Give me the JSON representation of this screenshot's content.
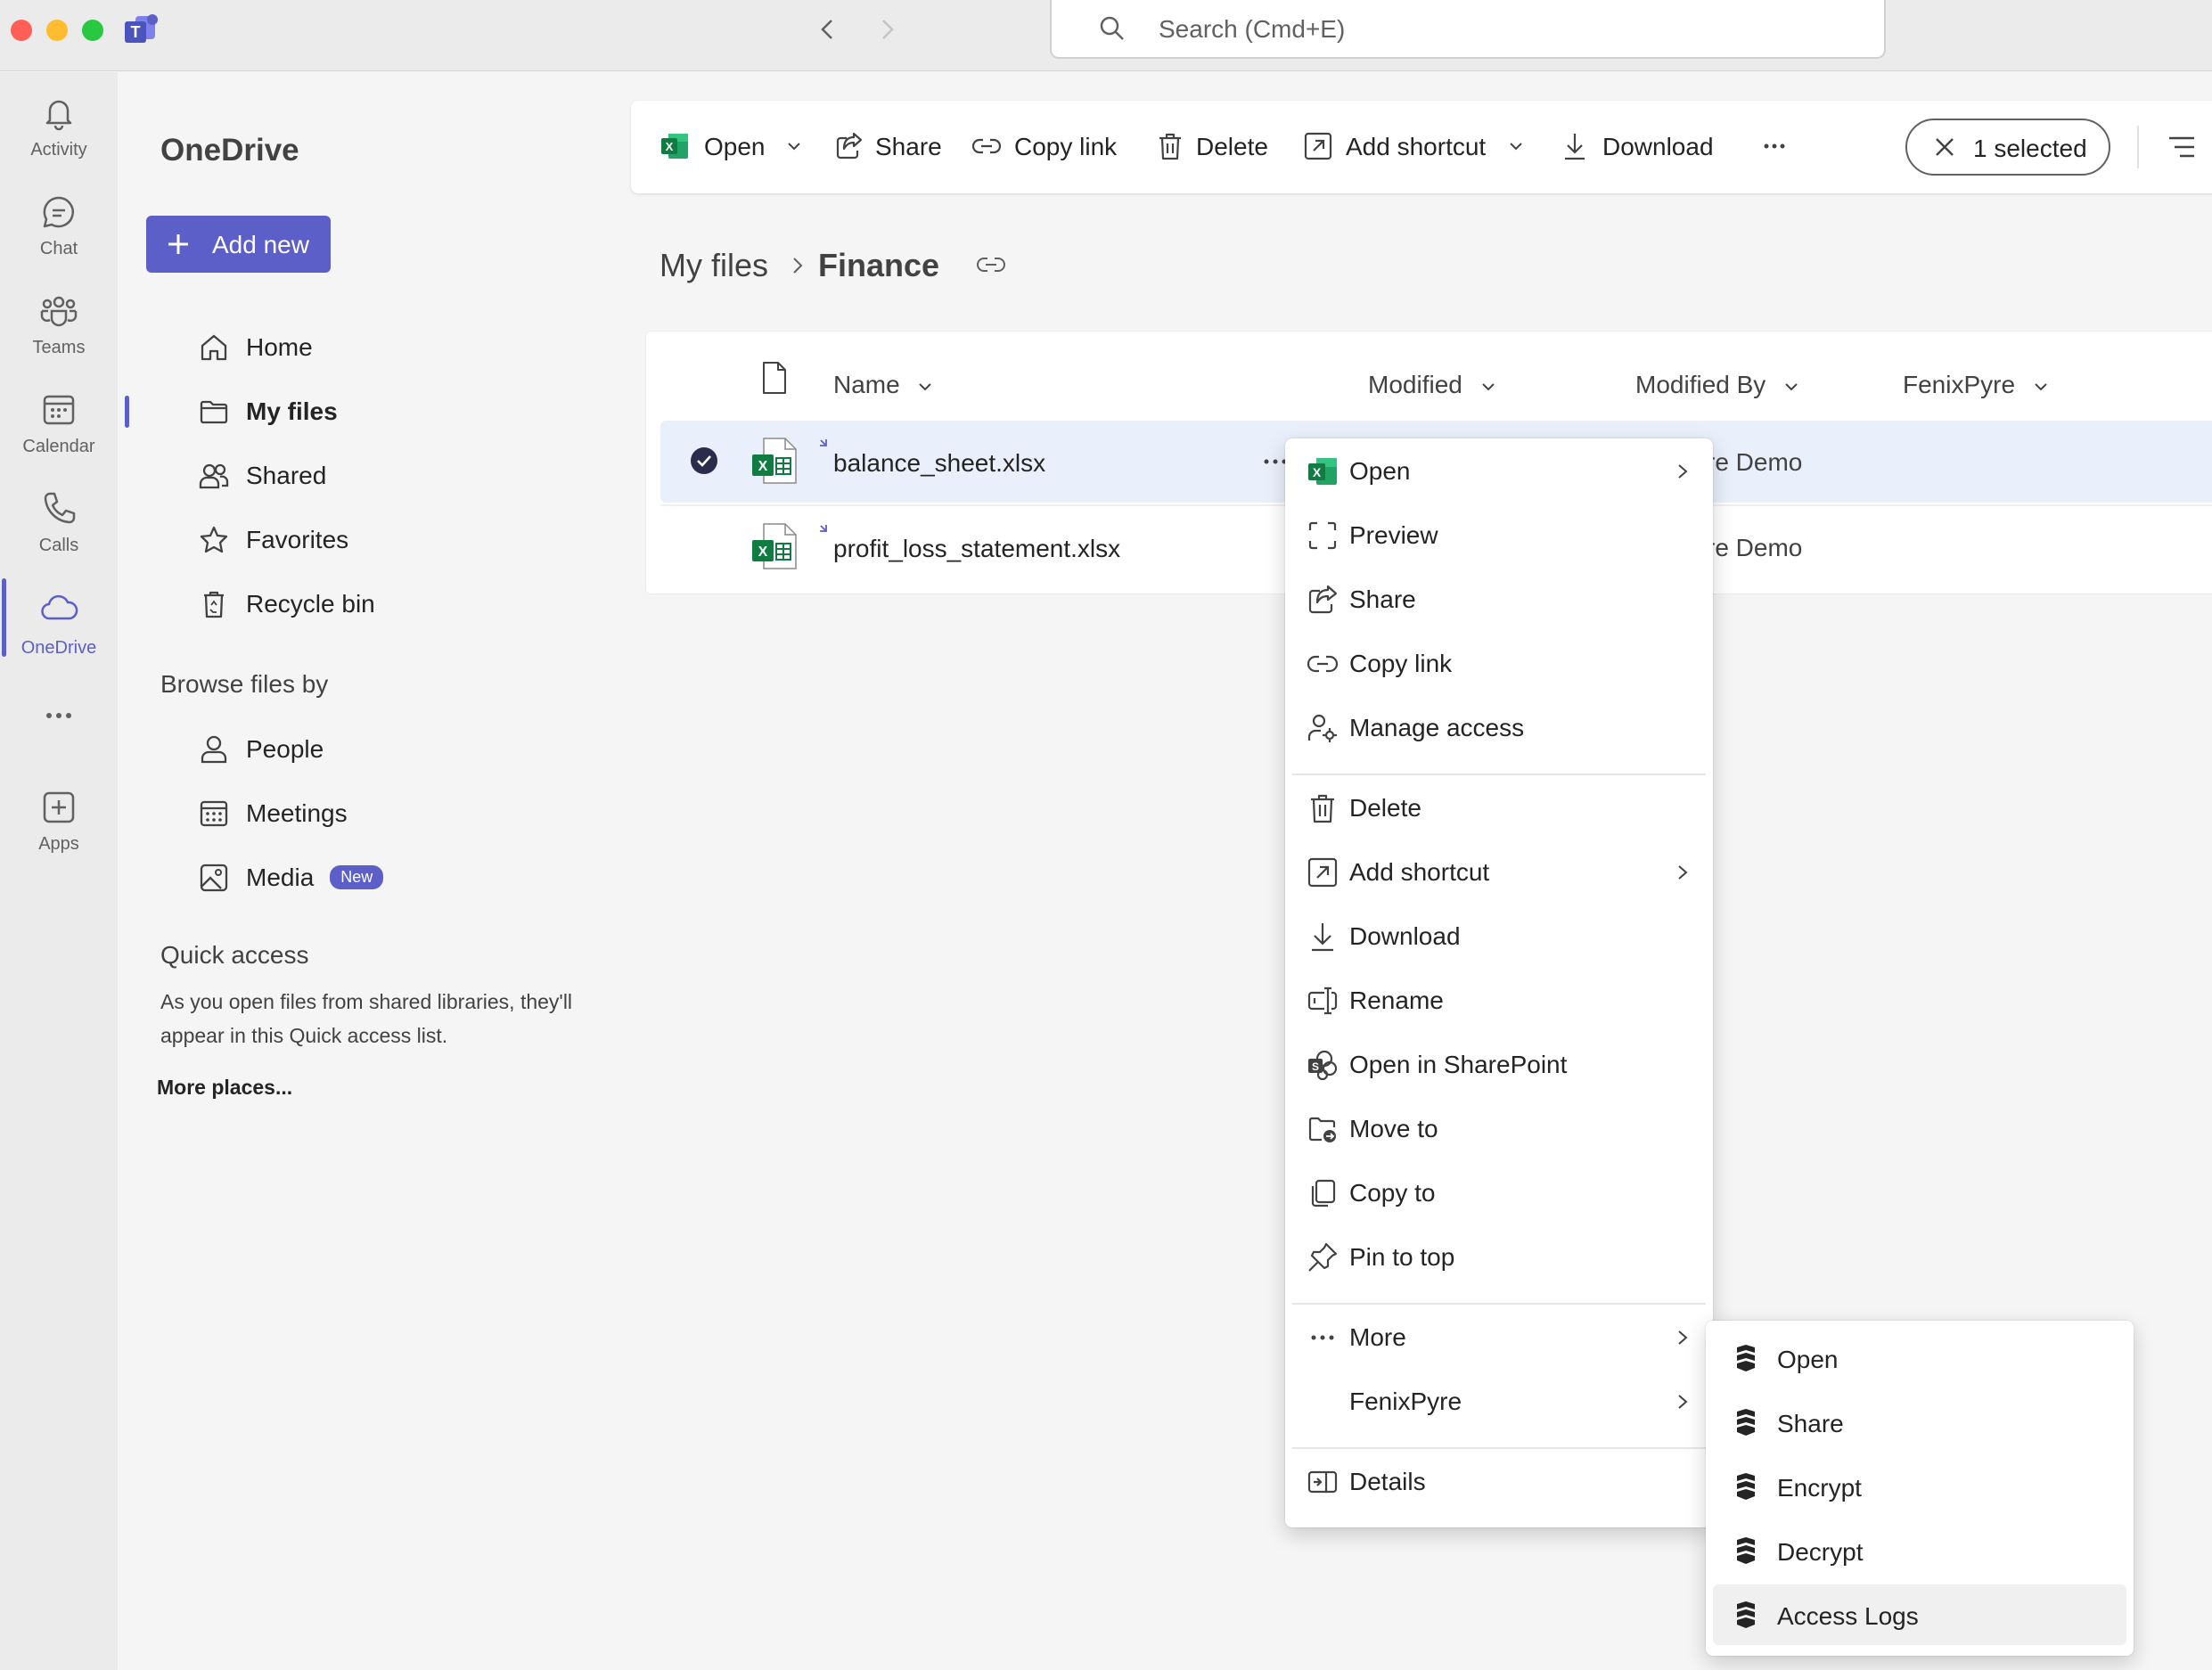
{
  "colors": {
    "accent": "#5b5fc7",
    "excel": "#107c41",
    "selected_row": "#eaf0fb"
  },
  "titlebar": {
    "search_placeholder": "Search (Cmd+E)"
  },
  "rail": {
    "items": [
      {
        "label": "Activity",
        "icon": "bell-icon"
      },
      {
        "label": "Chat",
        "icon": "chat-icon"
      },
      {
        "label": "Teams",
        "icon": "teams-icon"
      },
      {
        "label": "Calendar",
        "icon": "calendar-icon"
      },
      {
        "label": "Calls",
        "icon": "phone-icon"
      },
      {
        "label": "OneDrive",
        "icon": "cloud-icon",
        "active": true
      },
      {
        "label": "",
        "icon": "more-icon"
      },
      {
        "label": "Apps",
        "icon": "add-app-icon"
      }
    ]
  },
  "leftnav": {
    "title": "OneDrive",
    "add_new": "Add new",
    "items": [
      {
        "label": "Home",
        "icon": "home-icon"
      },
      {
        "label": "My files",
        "icon": "folder-icon",
        "active": true
      },
      {
        "label": "Shared",
        "icon": "people-icon"
      },
      {
        "label": "Favorites",
        "icon": "star-icon"
      },
      {
        "label": "Recycle bin",
        "icon": "recycle-bin-icon"
      }
    ],
    "browse_heading": "Browse files by",
    "browse_items": [
      {
        "label": "People",
        "icon": "person-icon"
      },
      {
        "label": "Meetings",
        "icon": "calendar-icon"
      },
      {
        "label": "Media",
        "icon": "image-icon",
        "badge": "New"
      }
    ],
    "quick_access_heading": "Quick access",
    "quick_access_text_1": "As you open files from shared libraries, they'll",
    "quick_access_text_2": "appear in this Quick access list.",
    "more_places": "More places..."
  },
  "toolbar": {
    "open": "Open",
    "share": "Share",
    "copy_link": "Copy link",
    "delete": "Delete",
    "add_shortcut": "Add shortcut",
    "download": "Download",
    "selected": "1 selected"
  },
  "breadcrumb": {
    "parent": "My files",
    "current": "Finance"
  },
  "filelist": {
    "columns": [
      "Name",
      "Modified",
      "Modified By",
      "FenixPyre"
    ],
    "rows": [
      {
        "name": "balance_sheet.xlsx",
        "modified_by": "re Demo",
        "selected": true
      },
      {
        "name": "profit_loss_statement.xlsx",
        "modified_by": "re Demo",
        "selected": false
      }
    ]
  },
  "context_menu": {
    "items": [
      {
        "label": "Open",
        "icon": "excel-icon",
        "submenu": true
      },
      {
        "label": "Preview",
        "icon": "preview-icon"
      },
      {
        "label": "Share",
        "icon": "share-icon"
      },
      {
        "label": "Copy link",
        "icon": "link-icon"
      },
      {
        "label": "Manage access",
        "icon": "manage-access-icon"
      },
      {
        "label": "Delete",
        "icon": "trash-icon"
      },
      {
        "label": "Add shortcut",
        "icon": "shortcut-icon",
        "submenu": true
      },
      {
        "label": "Download",
        "icon": "download-icon"
      },
      {
        "label": "Rename",
        "icon": "rename-icon"
      },
      {
        "label": "Open in SharePoint",
        "icon": "sharepoint-icon"
      },
      {
        "label": "Move to",
        "icon": "move-icon"
      },
      {
        "label": "Copy to",
        "icon": "copy-icon"
      },
      {
        "label": "Pin to top",
        "icon": "pin-icon"
      },
      {
        "label": "More",
        "icon": "more-icon",
        "submenu": true
      },
      {
        "label": "FenixPyre",
        "icon": "",
        "submenu": true
      },
      {
        "label": "Details",
        "icon": "details-icon"
      }
    ]
  },
  "submenu": {
    "items": [
      {
        "label": "Open",
        "icon": "fenixpyre-icon"
      },
      {
        "label": "Share",
        "icon": "fenixpyre-icon"
      },
      {
        "label": "Encrypt",
        "icon": "fenixpyre-icon"
      },
      {
        "label": "Decrypt",
        "icon": "fenixpyre-icon"
      },
      {
        "label": "Access Logs",
        "icon": "fenixpyre-icon",
        "hovered": true
      }
    ]
  }
}
